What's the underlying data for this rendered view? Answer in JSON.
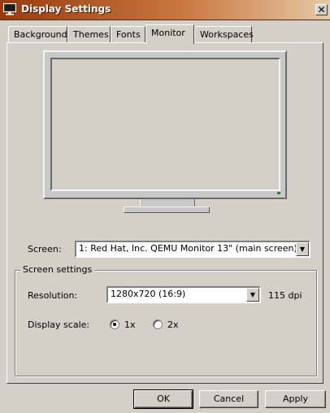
{
  "window": {
    "title": "Display Settings"
  },
  "icons": {
    "app": "monitor-icon",
    "close": "close-icon"
  },
  "tabs": [
    {
      "label": "Background",
      "active": false
    },
    {
      "label": "Themes",
      "active": false
    },
    {
      "label": "Fonts",
      "active": false
    },
    {
      "label": "Monitor",
      "active": true
    },
    {
      "label": "Workspaces",
      "active": false
    }
  ],
  "screen": {
    "label": "Screen:",
    "value": "1: Red Hat, Inc. QEMU Monitor 13\" (main screen)"
  },
  "screen_settings": {
    "title": "Screen settings",
    "resolution_label": "Resolution:",
    "resolution_value": "1280x720 (16:9)",
    "dpi": "115 dpi",
    "scale_label": "Display scale:",
    "scale_options": [
      {
        "label": "1x",
        "selected": true
      },
      {
        "label": "2x",
        "selected": false
      }
    ]
  },
  "buttons": {
    "ok": "OK",
    "cancel": "Cancel",
    "apply": "Apply"
  },
  "colors": {
    "titlebar_start": "#9a3b0e",
    "titlebar_end": "#e6c9a8",
    "face": "#d4d0c8",
    "power_led": "#1a8a1a"
  }
}
